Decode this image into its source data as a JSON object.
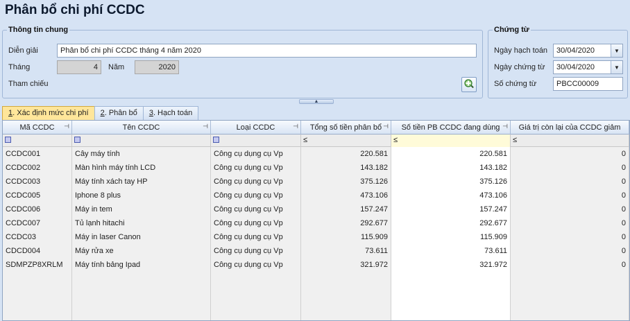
{
  "title": "Phân bổ chi phí CCDC",
  "general": {
    "legend": "Thông tin chung",
    "dien_giai_label": "Diễn giải",
    "dien_giai_value": "Phân bổ chi phí CCDC tháng 4 năm 2020",
    "thang_label": "Tháng",
    "thang_value": "4",
    "nam_label": "Năm",
    "nam_value": "2020",
    "tham_chieu_label": "Tham chiếu"
  },
  "voucher": {
    "legend": "Chứng từ",
    "ngay_hach_toan_label": "Ngày hạch toán",
    "ngay_hach_toan_value": "30/04/2020",
    "ngay_chung_tu_label": "Ngày chứng từ",
    "ngay_chung_tu_value": "30/04/2020",
    "so_chung_tu_label": "Số chứng từ",
    "so_chung_tu_value": "PBCC00009"
  },
  "tabs": [
    {
      "num": "1",
      "label": ". Xác định mức chi phí"
    },
    {
      "num": "2",
      "label": ". Phân bổ"
    },
    {
      "num": "3",
      "label": ". Hạch toán"
    }
  ],
  "grid": {
    "columns": [
      "Mã CCDC",
      "Tên CCDC",
      "Loại CCDC",
      "Tổng số tiền phân bổ",
      "Số tiền PB CCDC đang dùng",
      "Giá trị còn lại của CCDC giảm"
    ],
    "filter_le": "≤",
    "rows": [
      {
        "ma": "CCDC001",
        "ten": "Cây máy tính",
        "loai": "Công cụ dụng cụ Vp",
        "tong": "220.581",
        "pb": "220.581",
        "con_lai": "0"
      },
      {
        "ma": "CCDC002",
        "ten": "Màn hình máy tính LCD",
        "loai": "Công cụ dụng cụ Vp",
        "tong": "143.182",
        "pb": "143.182",
        "con_lai": "0"
      },
      {
        "ma": "CCDC003",
        "ten": "Máy tính xách tay HP",
        "loai": "Công cụ dụng cụ Vp",
        "tong": "375.126",
        "pb": "375.126",
        "con_lai": "0"
      },
      {
        "ma": "CCDC005",
        "ten": "Iphone 8 plus",
        "loai": "Công cụ dụng cụ Vp",
        "tong": "473.106",
        "pb": "473.106",
        "con_lai": "0"
      },
      {
        "ma": "CCDC006",
        "ten": "Máy in tem",
        "loai": "Công cụ dụng cụ Vp",
        "tong": "157.247",
        "pb": "157.247",
        "con_lai": "0"
      },
      {
        "ma": "CCDC007",
        "ten": "Tủ lạnh hitachi",
        "loai": "Công cụ dụng cụ Vp",
        "tong": "292.677",
        "pb": "292.677",
        "con_lai": "0"
      },
      {
        "ma": "CCDC03",
        "ten": "Máy in laser Canon",
        "loai": "Công cụ dụng cụ Vp",
        "tong": "115.909",
        "pb": "115.909",
        "con_lai": "0"
      },
      {
        "ma": "CDCD004",
        "ten": "Máy rửa xe",
        "loai": "Công cụ dụng cụ Vp",
        "tong": "73.611",
        "pb": "73.611",
        "con_lai": "0"
      },
      {
        "ma": "SDMPZP8XRLM",
        "ten": "Máy tính bảng Ipad",
        "loai": "Công cụ dụng cụ Vp",
        "tong": "321.972",
        "pb": "321.972",
        "con_lai": "0"
      }
    ]
  }
}
